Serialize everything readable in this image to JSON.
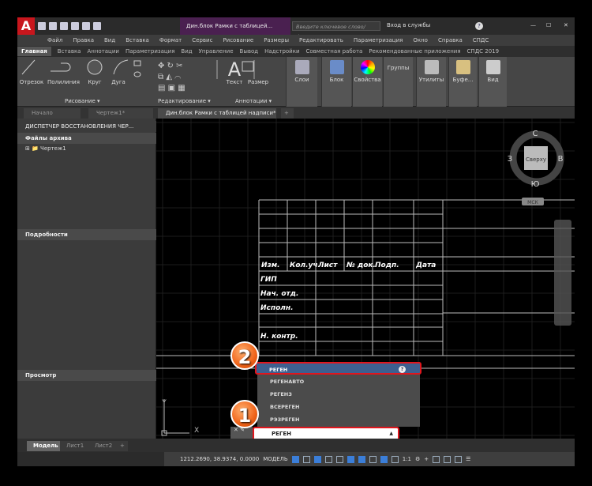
{
  "titlebar": {
    "logo": "A",
    "document": "Дин.блок Рамки с таблицей...",
    "search_placeholder": "Введите ключевое слово/фразу",
    "signin": "Вход в службы",
    "help": "?"
  },
  "menu": [
    "Файл",
    "Правка",
    "Вид",
    "Вставка",
    "Формат",
    "Сервис",
    "Рисование",
    "Размеры",
    "Редактировать",
    "Параметризация",
    "Окно",
    "Справка",
    "СПДС"
  ],
  "ribbon_tabs": [
    "Главная",
    "Вставка",
    "Аннотации",
    "Параметризация",
    "Вид",
    "Управление",
    "Вывод",
    "Надстройки",
    "Совместная работа",
    "Рекомендованные приложения",
    "СПДС 2019"
  ],
  "ribbon": {
    "tools": [
      "Отрезок",
      "Полилиния",
      "Круг",
      "Дуга",
      "Текст",
      "Размер"
    ],
    "groups": [
      "Рисование ▾",
      "Редактирование ▾",
      "Аннотации ▾"
    ],
    "panels": [
      "Слои",
      "Блок",
      "Свойства",
      "Группы",
      "Утилиты",
      "Буфе...",
      "Вид"
    ]
  },
  "doc_tabs": [
    "Начало",
    "Чертеж1*",
    "Дин.блок Рамки с таблицей надписи*",
    "+"
  ],
  "palette": {
    "title": "ДИСПЕТЧЕР ВОССТАНОВЛЕНИЯ ЧЕР...",
    "archive": "Файлы архива",
    "item": "Чертеж1",
    "details": "Подробности",
    "preview": "Просмотр"
  },
  "viewcube": {
    "n": "С",
    "s": "Ю",
    "w": "З",
    "e": "В",
    "face": "Сверху",
    "ucs": "МСК"
  },
  "table": {
    "header": [
      "Изм.",
      "Кол.уч.",
      "Лист",
      "№ док.",
      "Подп.",
      "Дата"
    ],
    "rows": [
      "ГИП",
      "Нач. отд.",
      "Исполн.",
      "",
      "Н. контр."
    ]
  },
  "axes": {
    "x": "X",
    "y": "Y"
  },
  "dropdown": [
    "РЕГЕН",
    "РЕГЕНАВТО",
    "РЕГЕНЗ",
    "ВСЕРЕГЕН",
    "РЭЗРЕГЕН"
  ],
  "command": {
    "value": "РЕГЕН"
  },
  "badges": [
    "1",
    "2"
  ],
  "layout_tabs": [
    "Модель",
    "Лист1",
    "Лист2",
    "+"
  ],
  "status": {
    "coords": "1212.2690, 38.9374, 0.0000",
    "space": "МОДЕЛЬ",
    "scale": "1:1"
  },
  "colors": {
    "accent": "#e0161d",
    "badge": "#f0641a",
    "highlight": "#3d5f8f"
  }
}
